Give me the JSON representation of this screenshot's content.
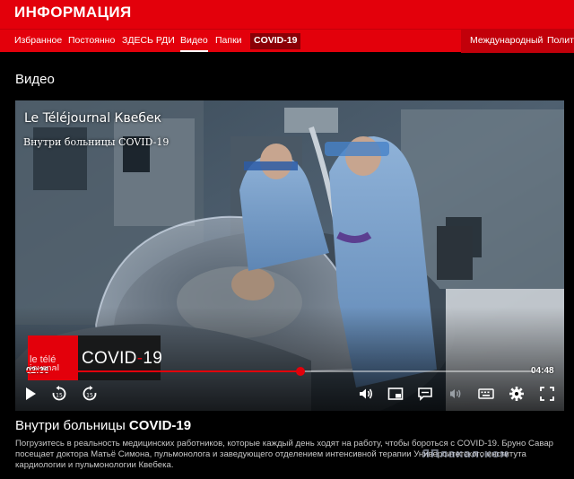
{
  "app": {
    "title": "ИНФОРМАЦИЯ"
  },
  "nav": {
    "items": [
      {
        "label": "Избранное"
      },
      {
        "label": "Постоянно"
      },
      {
        "label": "ЗДЕСЬ РДИ"
      },
      {
        "label": "Видео"
      },
      {
        "label": "Папки"
      },
      {
        "label": "COVID-19"
      }
    ],
    "right_items": [
      {
        "label": "Международный"
      },
      {
        "label": "Полит"
      }
    ]
  },
  "section": {
    "title": "Видео"
  },
  "player": {
    "watermark_show": "Le Téléjournal Квебек",
    "watermark_subtitle": "Внутри больницы COVID-19",
    "logo_text_1": "le télé",
    "logo_text_2": "journal",
    "covid_prefix": "COVID",
    "covid_dash": "-",
    "covid_suffix": "19",
    "current_time": "02:36",
    "duration": "04:48",
    "progress": 0.54,
    "accent_color": "#e3000b",
    "controls": {
      "play": "play-icon",
      "rewind": "rewind-15-icon",
      "forward": "forward-15-icon",
      "volume": "volume-icon",
      "pip": "picture-in-picture-icon",
      "captions": "captions-icon",
      "audio_description": "audio-description-icon",
      "keyboard": "keyboard-icon",
      "settings": "gear-icon",
      "fullscreen": "fullscreen-icon"
    }
  },
  "video": {
    "title_prefix": "Внутри больницы ",
    "title_bold": "COVID-19",
    "description": "Погрузитесь в реальность медицинских работников, которые каждый день ходят на работу, чтобы бороться с COVID-19. Бруно Савар посещает доктора Матьё Симона, пульмонолога и заведующего отделением интенсивной терапии Университетского института кардиологии и пульмонологии Квебека."
  },
  "site_watermark": "ЯПлакал.ком"
}
